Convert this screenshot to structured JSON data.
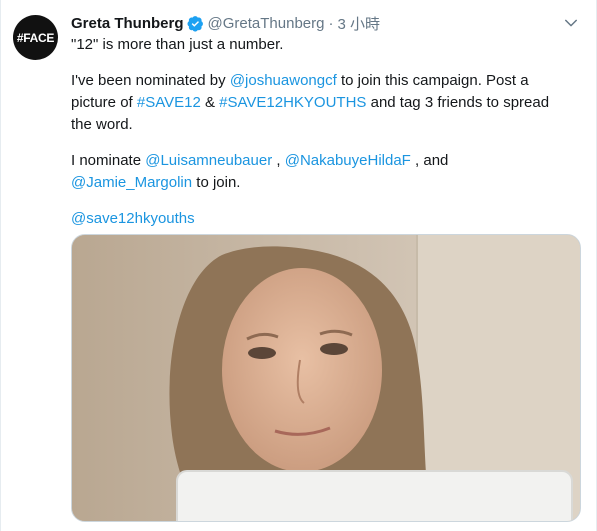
{
  "tweet": {
    "display_name": "Greta Thunberg",
    "handle": "@GretaThunberg",
    "separator": "·",
    "time": "3 小時",
    "avatar_text": "#FACE",
    "line1": "\"12\" is more than just a number.",
    "p2": {
      "t1": "I've been nominated by ",
      "mention1": "@joshuawongcf",
      "t2": " to join this campaign. Post a picture of ",
      "tag1": "#SAVE12",
      "t3": " & ",
      "tag2": "#SAVE12HKYOUTHS",
      "t4": " and tag 3 friends to spread the word."
    },
    "p3": {
      "t1": "I nominate ",
      "mention1": "@Luisamneubauer",
      "t2": " , ",
      "mention2": "@NakabuyeHildaF",
      "t3": " , and ",
      "mention3": "@Jamie_Margolin",
      "t4": " to join."
    },
    "p4": {
      "mention1": "@save12hkyouths"
    }
  },
  "colors": {
    "link": "#1b95e0",
    "verified": "#1da1f2",
    "muted": "#657786"
  },
  "icons": {
    "verified": "verified-badge-icon",
    "caret": "chevron-down-icon"
  }
}
